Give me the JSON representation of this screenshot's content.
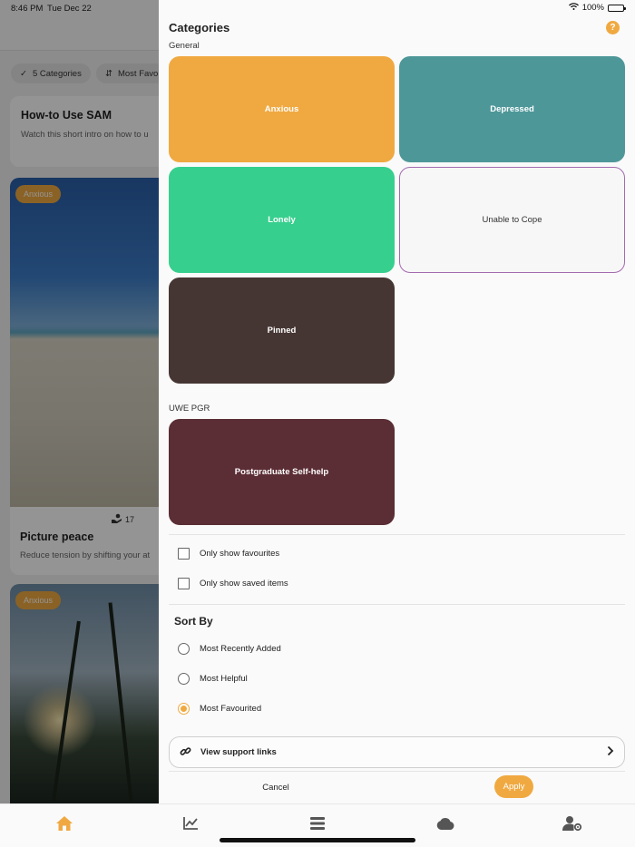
{
  "status_bar": {
    "time": "8:46 PM",
    "date": "Tue Dec 22",
    "battery": "100%"
  },
  "background": {
    "chips": {
      "categories": "5 Categories",
      "sort": "Most Favo"
    },
    "howto": {
      "title": "How-to Use SAM",
      "subtitle": "Watch this short intro on how to u"
    },
    "card1": {
      "badge": "Anxious",
      "likes": "17",
      "title": "Picture peace",
      "subtitle": "Reduce tension by shifting your at"
    },
    "card2": {
      "badge": "Anxious"
    }
  },
  "sheet": {
    "title": "Categories",
    "help_symbol": "?",
    "groups": [
      {
        "label": "General",
        "categories": [
          "Anxious",
          "Depressed",
          "Lonely",
          "Unable to Cope",
          "Pinned"
        ]
      },
      {
        "label": "UWE PGR",
        "categories": [
          "Postgraduate Self-help"
        ]
      }
    ],
    "category_colors": {
      "Anxious": "#f0a941",
      "Depressed": "#4e9799",
      "Lonely": "#37cf8e",
      "Unable to Cope": "#f7f7f7",
      "Pinned": "#463633",
      "Postgraduate Self-help": "#5b2d34"
    },
    "filters": {
      "only_favourites": {
        "label": "Only show favourites",
        "checked": false
      },
      "only_saved": {
        "label": "Only show saved items",
        "checked": false
      }
    },
    "sort": {
      "title": "Sort By",
      "options": [
        "Most Recently Added",
        "Most Helpful",
        "Most Favourited"
      ],
      "selected": "Most Favourited"
    },
    "support_link": "View support links",
    "cancel": "Cancel",
    "apply": "Apply"
  },
  "tab_bar": [
    "home-icon",
    "progress-chart-icon",
    "menu-icon",
    "cloud-icon",
    "user-settings-icon"
  ],
  "accent_color": "#f0a941"
}
